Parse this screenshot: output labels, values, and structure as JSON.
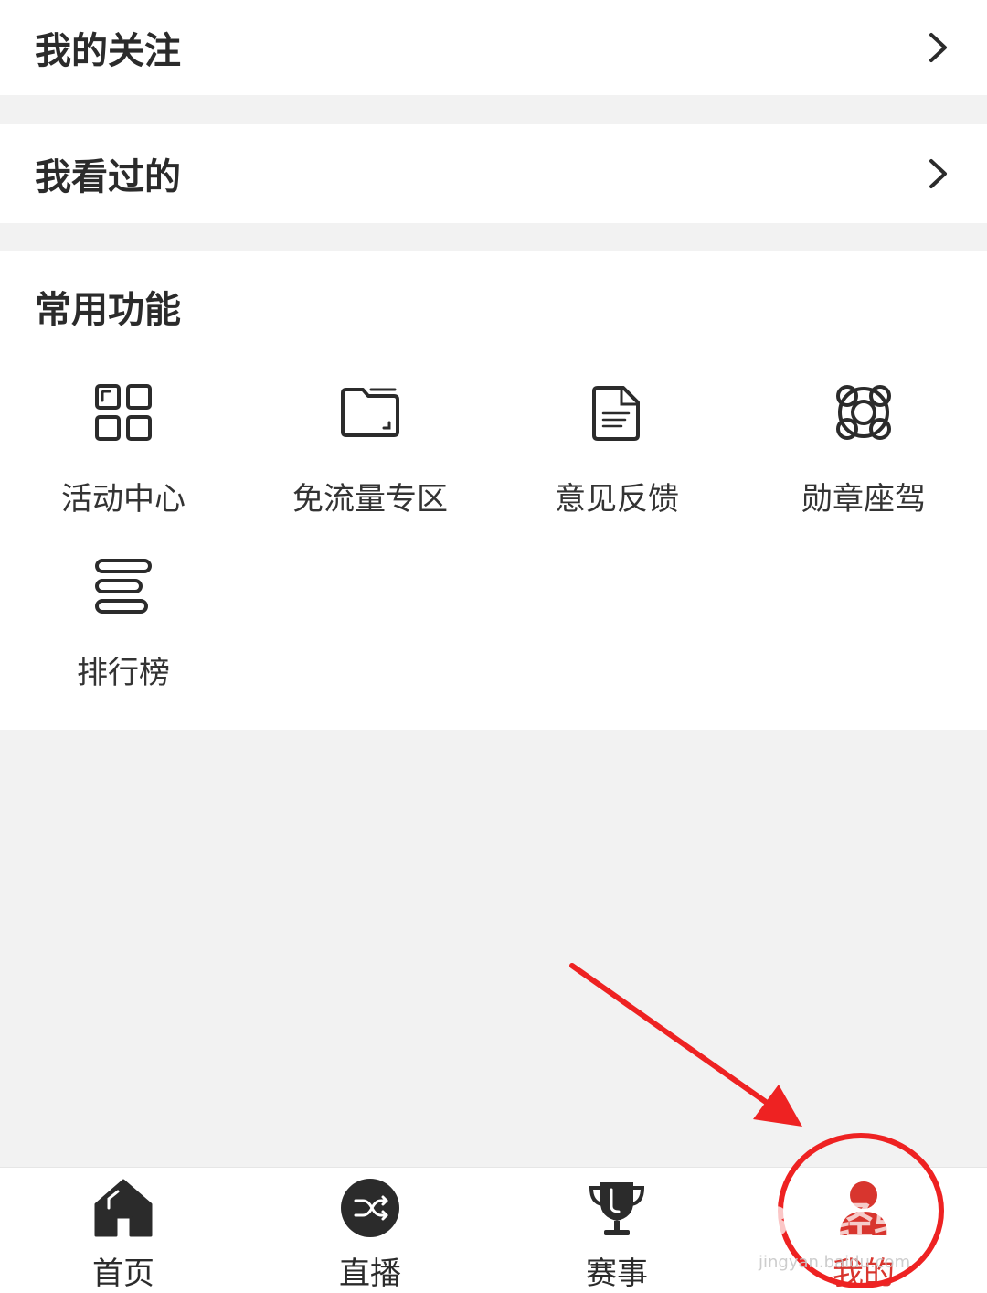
{
  "rows": [
    {
      "title": "我的关注"
    },
    {
      "title": "我看过的"
    }
  ],
  "functions": {
    "title": "常用功能",
    "items": [
      {
        "label": "活动中心",
        "icon": "grid-icon"
      },
      {
        "label": "免流量专区",
        "icon": "folder-icon"
      },
      {
        "label": "意见反馈",
        "icon": "document-icon"
      },
      {
        "label": "勋章座驾",
        "icon": "lifebuoy-icon"
      },
      {
        "label": "排行榜",
        "icon": "ranking-icon"
      }
    ]
  },
  "tabbar": {
    "items": [
      {
        "label": "首页",
        "icon": "home-icon",
        "active": false
      },
      {
        "label": "直播",
        "icon": "shuffle-icon",
        "active": false
      },
      {
        "label": "赛事",
        "icon": "trophy-icon",
        "active": false
      },
      {
        "label": "我的",
        "icon": "user-icon",
        "active": true
      }
    ]
  },
  "watermark": {
    "brand": "Bai经验",
    "url": "jingyan.baidu.com"
  },
  "colors": {
    "accent": "#d8352e",
    "annotation": "#ee2222",
    "background": "#f2f2f2"
  }
}
